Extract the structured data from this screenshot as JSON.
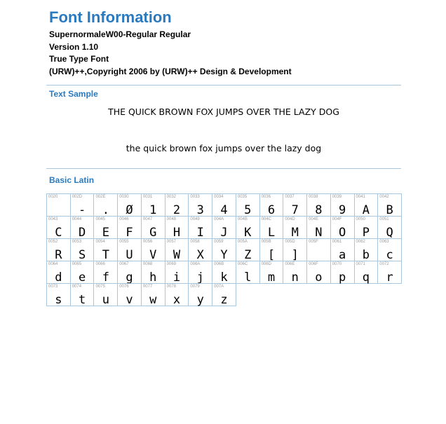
{
  "header": {
    "title": "Font Information",
    "font_name": "SupernormaleW00-Regular Regular",
    "version": "Version 1.10",
    "font_type": "True Type Font",
    "copyright": "(URW)++,Copyright 2006 by (URW)++ Design & Development"
  },
  "text_sample": {
    "heading": "Text Sample",
    "uppercase": "THE QUICK BROWN FOX JUMPS OVER THE LAZY DOG",
    "lowercase": "the quick brown fox jumps over the lazy dog"
  },
  "basic_latin": {
    "heading": "Basic Latin",
    "glyphs": [
      {
        "code": "0020",
        "char": ""
      },
      {
        "code": "002D",
        "char": "-"
      },
      {
        "code": "002E",
        "char": "."
      },
      {
        "code": "0030",
        "char": "Ø"
      },
      {
        "code": "0031",
        "char": "1"
      },
      {
        "code": "0032",
        "char": "2"
      },
      {
        "code": "0033",
        "char": "3"
      },
      {
        "code": "0034",
        "char": "4"
      },
      {
        "code": "0035",
        "char": "5"
      },
      {
        "code": "0036",
        "char": "6"
      },
      {
        "code": "0037",
        "char": "7"
      },
      {
        "code": "0038",
        "char": "8"
      },
      {
        "code": "0039",
        "char": "9"
      },
      {
        "code": "0041",
        "char": "A"
      },
      {
        "code": "0042",
        "char": "B"
      },
      {
        "code": "0043",
        "char": "C"
      },
      {
        "code": "0044",
        "char": "D"
      },
      {
        "code": "0045",
        "char": "E"
      },
      {
        "code": "0046",
        "char": "F"
      },
      {
        "code": "0047",
        "char": "G"
      },
      {
        "code": "0048",
        "char": "H"
      },
      {
        "code": "0049",
        "char": "I"
      },
      {
        "code": "004A",
        "char": "J"
      },
      {
        "code": "004B",
        "char": "K"
      },
      {
        "code": "004C",
        "char": "L"
      },
      {
        "code": "004D",
        "char": "M"
      },
      {
        "code": "004E",
        "char": "N"
      },
      {
        "code": "004F",
        "char": "O"
      },
      {
        "code": "0050",
        "char": "P"
      },
      {
        "code": "0051",
        "char": "Q"
      },
      {
        "code": "0052",
        "char": "R"
      },
      {
        "code": "0053",
        "char": "S"
      },
      {
        "code": "0054",
        "char": "T"
      },
      {
        "code": "0055",
        "char": "U"
      },
      {
        "code": "0056",
        "char": "V"
      },
      {
        "code": "0057",
        "char": "W"
      },
      {
        "code": "0058",
        "char": "X"
      },
      {
        "code": "0059",
        "char": "Y"
      },
      {
        "code": "005A",
        "char": "Z"
      },
      {
        "code": "005B",
        "char": "["
      },
      {
        "code": "005D",
        "char": "]"
      },
      {
        "code": "005F",
        "char": "_"
      },
      {
        "code": "0061",
        "char": "a"
      },
      {
        "code": "0062",
        "char": "b"
      },
      {
        "code": "0063",
        "char": "c"
      },
      {
        "code": "0064",
        "char": "d"
      },
      {
        "code": "0065",
        "char": "e"
      },
      {
        "code": "0066",
        "char": "f"
      },
      {
        "code": "0067",
        "char": "g"
      },
      {
        "code": "0068",
        "char": "h"
      },
      {
        "code": "0069",
        "char": "i"
      },
      {
        "code": "006A",
        "char": "j"
      },
      {
        "code": "006B",
        "char": "k"
      },
      {
        "code": "006C",
        "char": "l"
      },
      {
        "code": "006D",
        "char": "m"
      },
      {
        "code": "006E",
        "char": "n"
      },
      {
        "code": "006F",
        "char": "o"
      },
      {
        "code": "0070",
        "char": "p"
      },
      {
        "code": "0071",
        "char": "q"
      },
      {
        "code": "0072",
        "char": "r"
      },
      {
        "code": "0073",
        "char": "s"
      },
      {
        "code": "0074",
        "char": "t"
      },
      {
        "code": "0075",
        "char": "u"
      },
      {
        "code": "0076",
        "char": "v"
      },
      {
        "code": "0077",
        "char": "w"
      },
      {
        "code": "0078",
        "char": "x"
      },
      {
        "code": "0079",
        "char": "y"
      },
      {
        "code": "007A",
        "char": "z"
      }
    ]
  },
  "colors": {
    "accent": "#2a7ac0",
    "rule": "#a9c6df",
    "code_text": "#9a9a9a"
  }
}
